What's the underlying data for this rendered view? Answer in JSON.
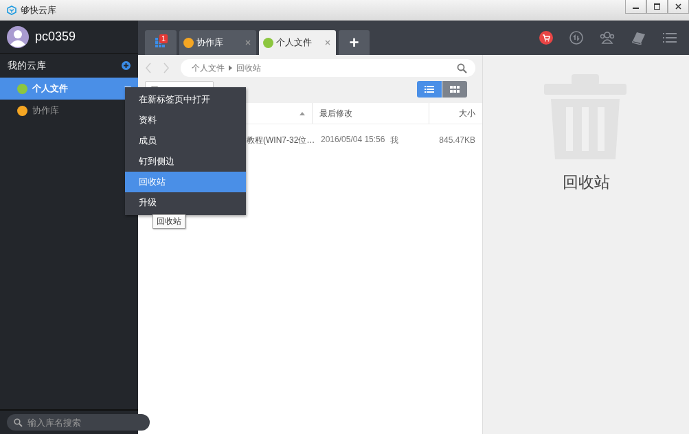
{
  "window": {
    "title": "够快云库"
  },
  "user": {
    "name": "pc0359"
  },
  "sidebar": {
    "section_title": "我的云库",
    "libraries": [
      {
        "name": "个人文件",
        "color": "#8cc63f",
        "selected": true
      },
      {
        "name": "协作库",
        "color": "#f5a623",
        "selected": false
      }
    ],
    "search": {
      "placeholder": "输入库名搜索"
    }
  },
  "tabs": [
    {
      "kind": "apps",
      "badge": "1",
      "selected": false
    },
    {
      "kind": "library",
      "label": "协作库",
      "color": "#f5a623",
      "selected": false
    },
    {
      "kind": "library",
      "label": "个人文件",
      "color": "#8cc63f",
      "selected": true
    }
  ],
  "new_tab": "+",
  "breadcrumb": [
    "个人文件",
    "回收站"
  ],
  "view_modes": [
    {
      "kind": "list",
      "selected": true
    },
    {
      "kind": "grid",
      "selected": false
    }
  ],
  "table": {
    "columns": [
      "最后修改",
      "大小"
    ],
    "rows": [
      {
        "name": "教程(WIN7-32位…",
        "modified": "2016/05/04 15:56",
        "owner": "我",
        "size": "845.47KB"
      }
    ]
  },
  "context_menu": [
    {
      "label": "在新标签页中打开",
      "selected": false
    },
    {
      "label": "资料",
      "selected": false
    },
    {
      "label": "成员",
      "selected": false
    },
    {
      "label": "钉到侧边",
      "selected": false
    },
    {
      "label": "回收站",
      "selected": true
    },
    {
      "label": "升级",
      "selected": false
    }
  ],
  "tooltip": "回收站",
  "detail": {
    "title": "回收站"
  }
}
